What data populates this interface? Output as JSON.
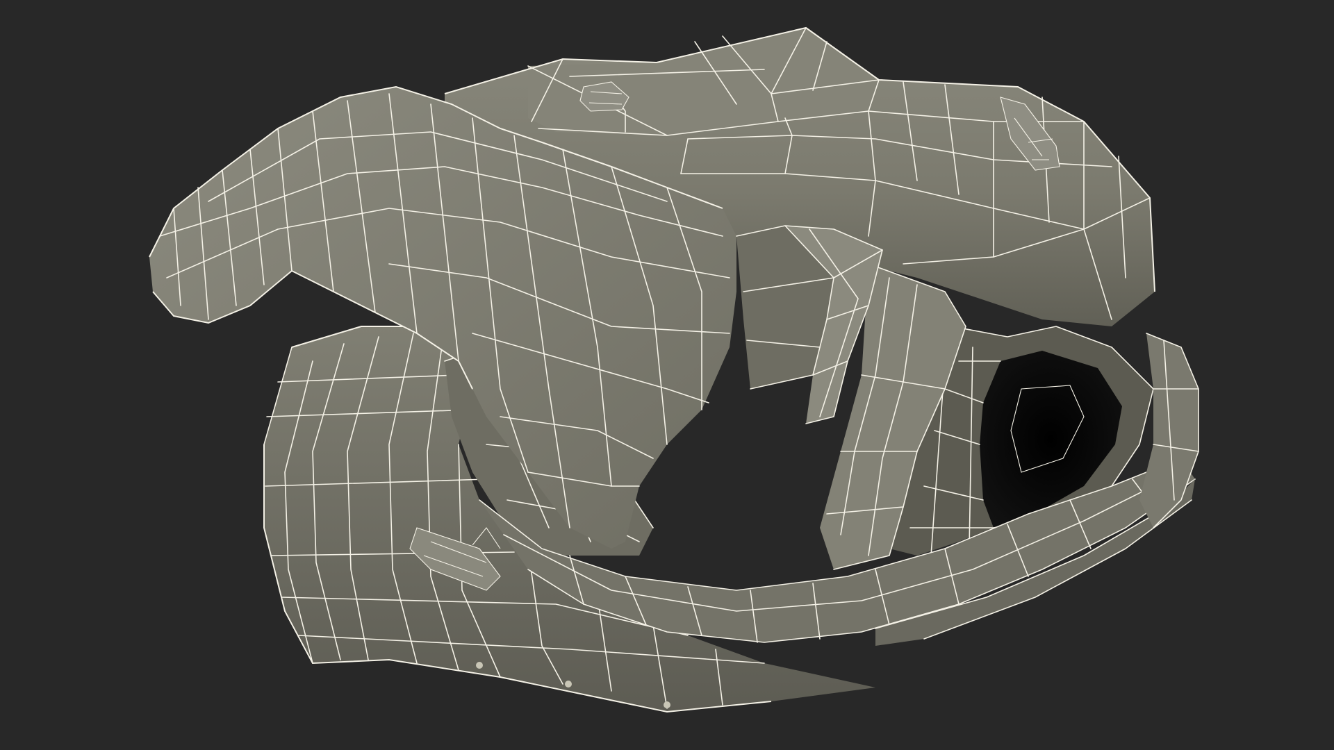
{
  "scene": {
    "subject": "helmet-wireframe-render",
    "background_color": "#282828",
    "surface_color": "#7d7c70",
    "surface_shadow_color": "#55544b",
    "surface_highlight_color": "#8e8d81",
    "wire_color": "#f4f1e6",
    "opening_color": "#050505"
  }
}
